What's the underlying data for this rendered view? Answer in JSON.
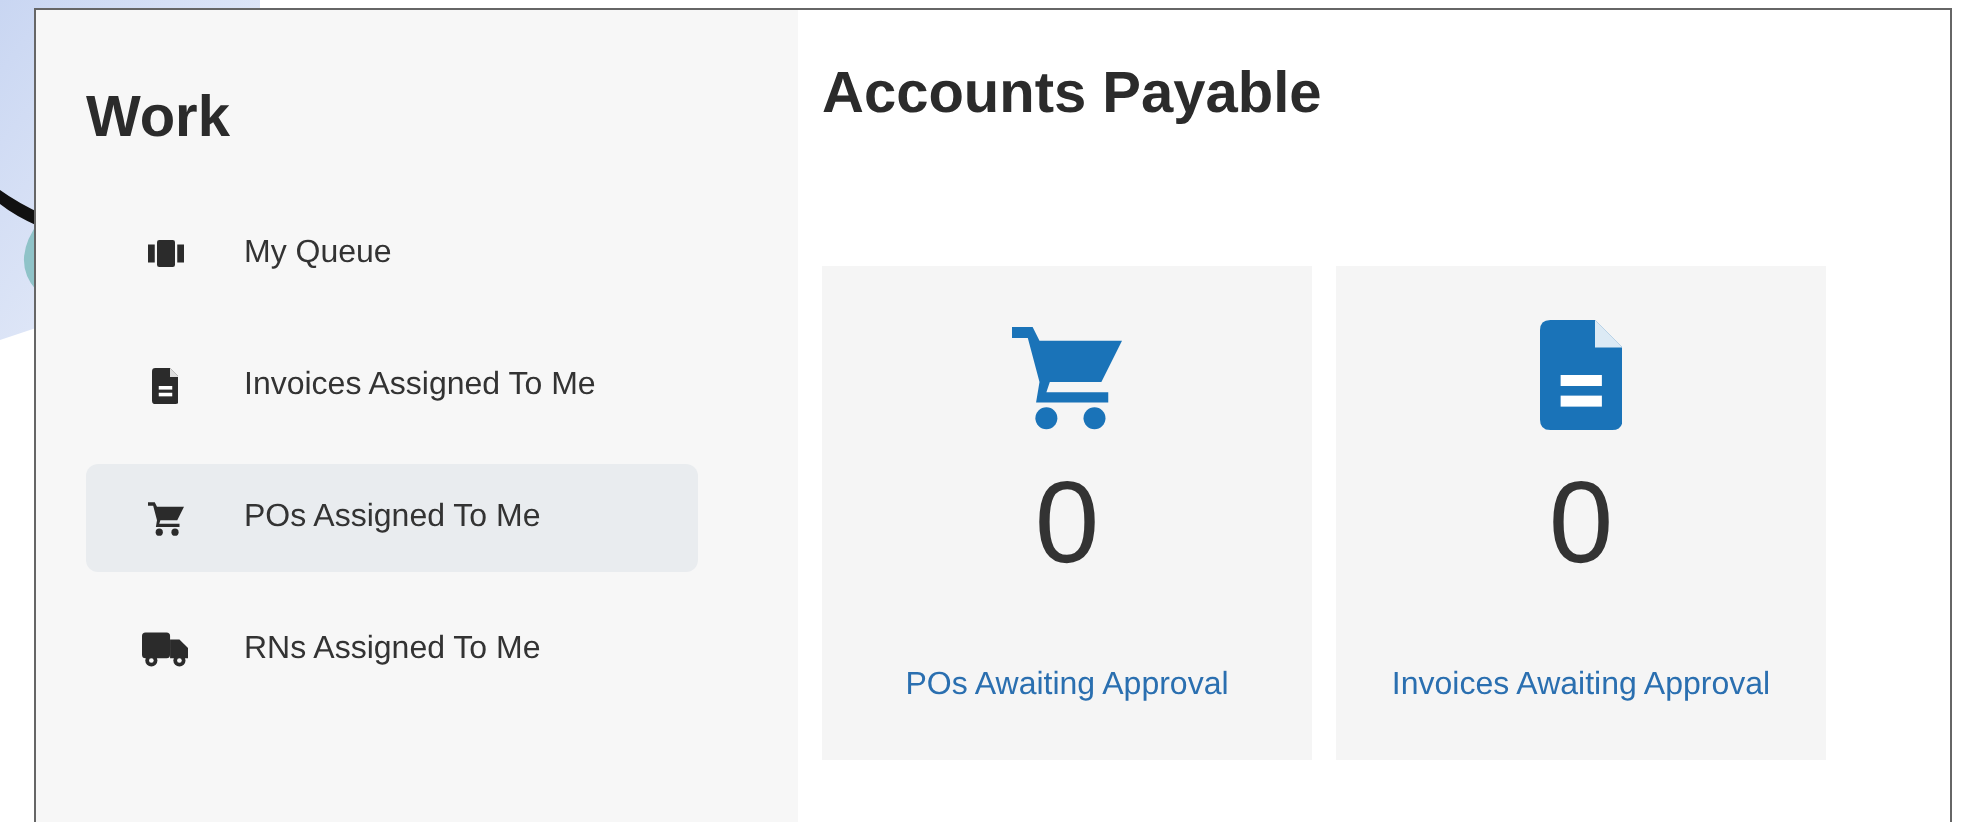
{
  "sidebar": {
    "title": "Work",
    "items": [
      {
        "kind": "queue",
        "label": "My Queue",
        "selected": false
      },
      {
        "kind": "document",
        "label": "Invoices Assigned To Me",
        "selected": false
      },
      {
        "kind": "cart",
        "label": "POs Assigned To Me",
        "selected": true
      },
      {
        "kind": "truck",
        "label": "RNs Assigned To Me",
        "selected": false
      }
    ]
  },
  "main": {
    "title": "Accounts Payable",
    "cards": [
      {
        "kind": "cart",
        "count": "0",
        "link": "POs Awaiting Approval"
      },
      {
        "kind": "document",
        "count": "0",
        "link": "Invoices Awaiting Approval"
      }
    ]
  }
}
